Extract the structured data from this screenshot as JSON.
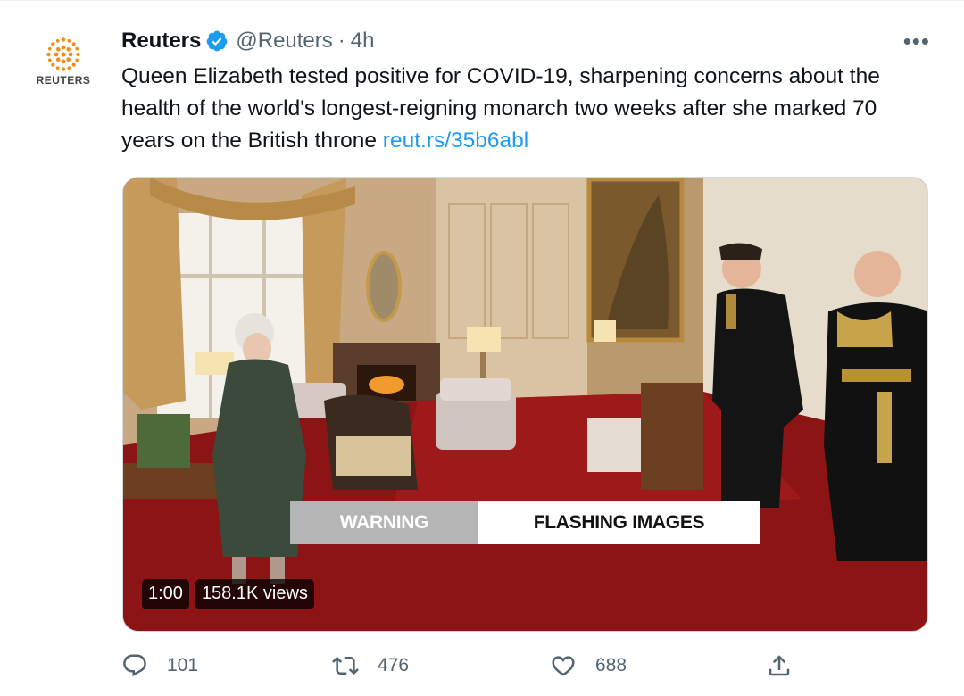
{
  "tweet": {
    "author": {
      "name": "Reuters",
      "handle": "@Reuters",
      "avatar_wordmark": "REUTERS",
      "verified_icon": "verified-badge-icon"
    },
    "separator": "·",
    "time": "4h",
    "more_icon": "more-horizontal-icon",
    "more_label": "•••",
    "text": "Queen Elizabeth tested positive for COVID-19, sharpening concerns about the health of the world's longest-reigning monarch two weeks after she marked 70 years on the British throne",
    "link": "reut.rs/35b6abl",
    "media": {
      "type": "video",
      "warning_label": "WARNING",
      "warning_text": "FLASHING IMAGES",
      "duration": "1:00",
      "views": "158.1K views"
    },
    "actions": {
      "reply_count": "101",
      "retweet_count": "476",
      "like_count": "688"
    }
  },
  "colors": {
    "accent": "#1d9bf0",
    "secondary_text": "#536471",
    "reuters_orange": "#f28c18"
  }
}
